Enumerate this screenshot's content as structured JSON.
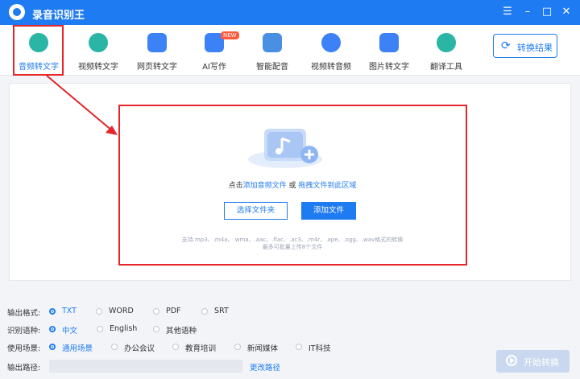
{
  "app": {
    "title": "录音识别王"
  },
  "window_controls": {
    "menu": "☰",
    "minimize": "–",
    "maximize": "□",
    "close": "✕"
  },
  "toolbar": {
    "items": [
      {
        "label": "音频转文字",
        "icon": "audio-to-text-icon",
        "color": "#2bb5a4"
      },
      {
        "label": "视频转文字",
        "icon": "video-to-text-icon",
        "color": "#2bb5a4"
      },
      {
        "label": "网页转文字",
        "icon": "webpage-to-text-icon",
        "color": "#3c82f6"
      },
      {
        "label": "AI写作",
        "icon": "ai-writing-icon",
        "color": "#3c82f6",
        "badge": "NEW"
      },
      {
        "label": "智能配音",
        "icon": "smart-dubbing-icon",
        "color": "#4a90e2"
      },
      {
        "label": "视频转音频",
        "icon": "video-to-audio-icon",
        "color": "#3c82f6"
      },
      {
        "label": "图片转文字",
        "icon": "image-to-text-icon",
        "color": "#3c82f6"
      },
      {
        "label": "翻译工具",
        "icon": "translate-icon",
        "color": "#2bb5a4"
      }
    ],
    "result_button": "转换结果"
  },
  "upload": {
    "prefix": "点击",
    "add_audio": "添加音频文件",
    "or": " 或 ",
    "drag": "拖拽文件到此区域",
    "select_folder": "选择文件夹",
    "add_file": "添加文件",
    "hint_formats": "支持.mp3、.m4a、.wma、.aac、.flac、.ac3、.m4r、.ape、.ogg、.wav格式的转换",
    "hint_limit": "最多可批量上传8个文件"
  },
  "options": {
    "format": {
      "label": "输出格式:",
      "choices": [
        "TXT",
        "WORD",
        "PDF",
        "SRT"
      ],
      "selected": "TXT"
    },
    "language": {
      "label": "识别语种:",
      "choices": [
        "中文",
        "English",
        "其他语种"
      ],
      "selected": "中文"
    },
    "scene": {
      "label": "使用场景:",
      "choices": [
        "通用场景",
        "办公会议",
        "教育培训",
        "新闻媒体",
        "IT科技"
      ],
      "selected": "通用场景"
    },
    "path": {
      "label": "输出路径:",
      "change": "更改路径"
    }
  },
  "start_button": "开始转换",
  "colors": {
    "accent": "#1f7bf1",
    "annotation": "#e5252a"
  }
}
